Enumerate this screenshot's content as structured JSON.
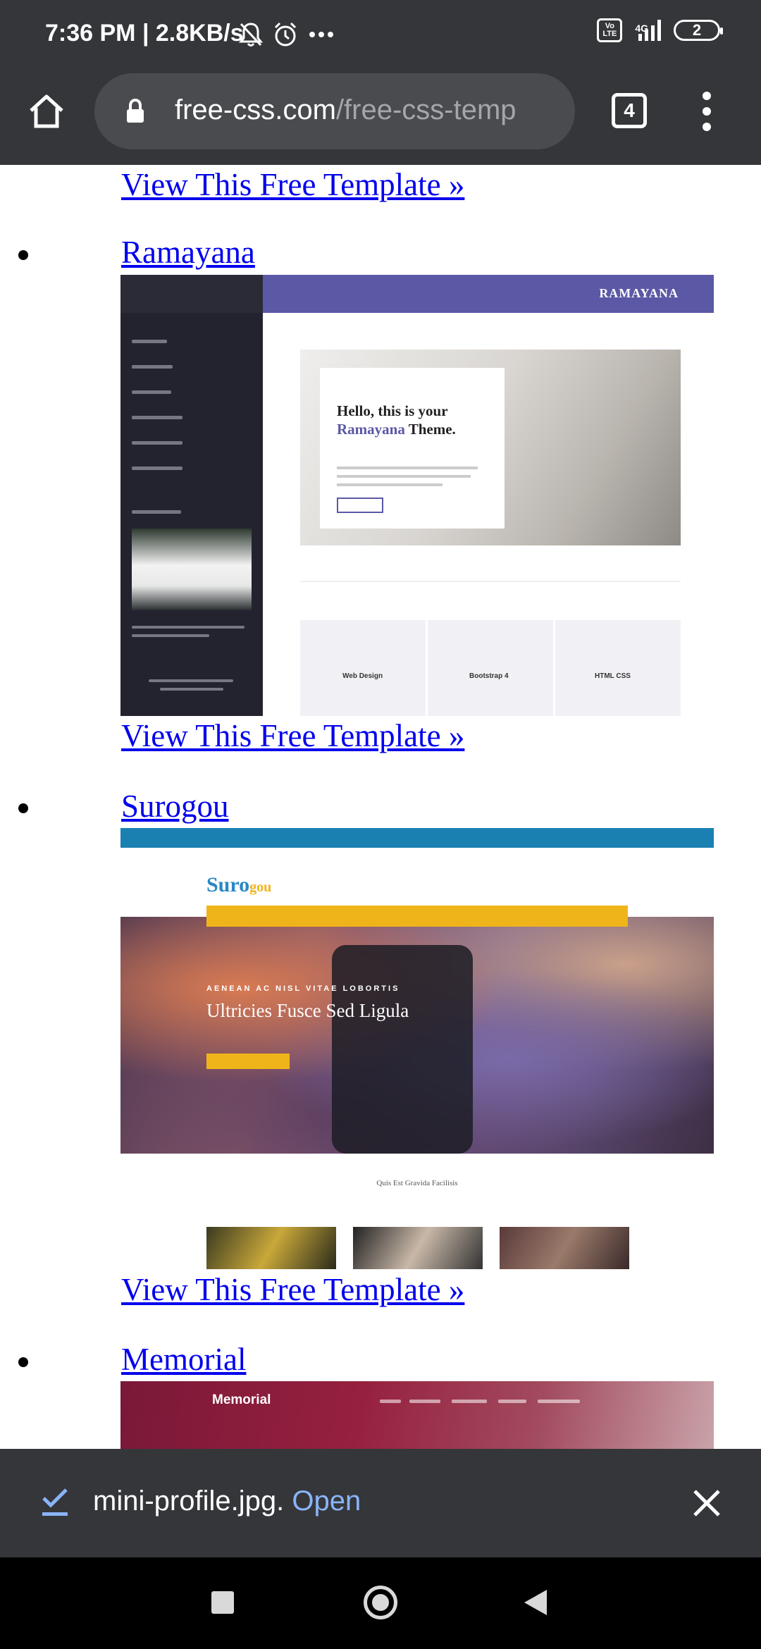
{
  "status_bar": {
    "time": "7:36 PM | 2.8KB/s",
    "volte": "Vo LTE",
    "network": "4G",
    "battery": "2"
  },
  "browser": {
    "url_domain": "free-css.com",
    "url_path": "/free-css-temp",
    "tab_count": "4"
  },
  "listing": {
    "top_link": "View This Free Template »",
    "items": [
      {
        "title": "Ramayana",
        "view_label": "View This Free Template »",
        "preview": {
          "brand": "RAMAYANA",
          "hero_line1": "Hello, this is your",
          "hero_accent": "Ramayana",
          "hero_line2_rest": " Theme.",
          "tiles": [
            "Web Design",
            "Bootstrap 4",
            "HTML CSS"
          ]
        }
      },
      {
        "title": "Surogou",
        "view_label": "View This Free Template »",
        "preview": {
          "logo_main": "Suro",
          "logo_accent": "gou",
          "kicker": "AENEAN AC NISL VITAE LOBORTIS",
          "headline": "Ultricies Fusce Sed Ligula",
          "section_title": "Quis Est Gravida Facilisis"
        }
      },
      {
        "title": "Memorial",
        "preview": {
          "logo": "Memorial"
        }
      }
    ]
  },
  "download_bar": {
    "filename": "mini-profile.jpg.",
    "action": "Open"
  },
  "colors": {
    "chrome_dark": "#35363a",
    "link_blue": "#0000ee",
    "open_blue": "#8ab4f8"
  }
}
